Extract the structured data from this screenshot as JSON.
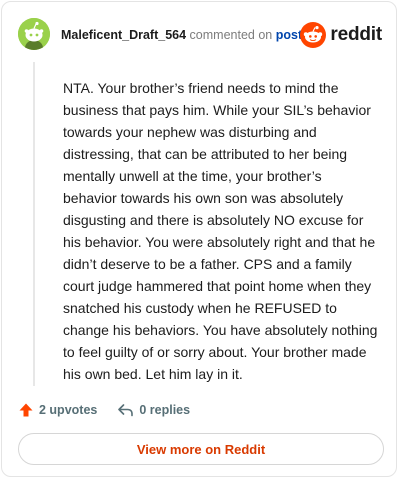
{
  "comment": {
    "username": "Maleficent_Draft_564",
    "action_text": "commented on",
    "post_link": "post",
    "body": "NTA. Your brother’s friend needs to mind the business that pays him. While your SIL’s behavior towards your nephew was disturbing and distressing, that can be attributed to her being mentally unwell at the time, your brother’s behavior towards his own son was absolutely disgusting and there is absolutely NO excuse for his behavior. You were absolutely right and that he didn’t deserve to be a father. CPS and a family court judge hammered that point home when they snatched his custody when he REFUSED to change his behaviors. You have absolutely nothing to feel guilty of or sorry about. Your brother made his own bed. Let him lay in it."
  },
  "brand": {
    "wordmark": "reddit",
    "color": "#ff4500"
  },
  "actions": {
    "upvotes": "2 upvotes",
    "replies": "0 replies",
    "upvote_icon": "upvote-arrow-icon",
    "reply_icon": "reply-arrow-icon"
  },
  "footer": {
    "view_more": "View more on Reddit"
  },
  "colors": {
    "accent": "#d93a00",
    "link": "#0045ac",
    "avatar": "#9ad14b"
  }
}
